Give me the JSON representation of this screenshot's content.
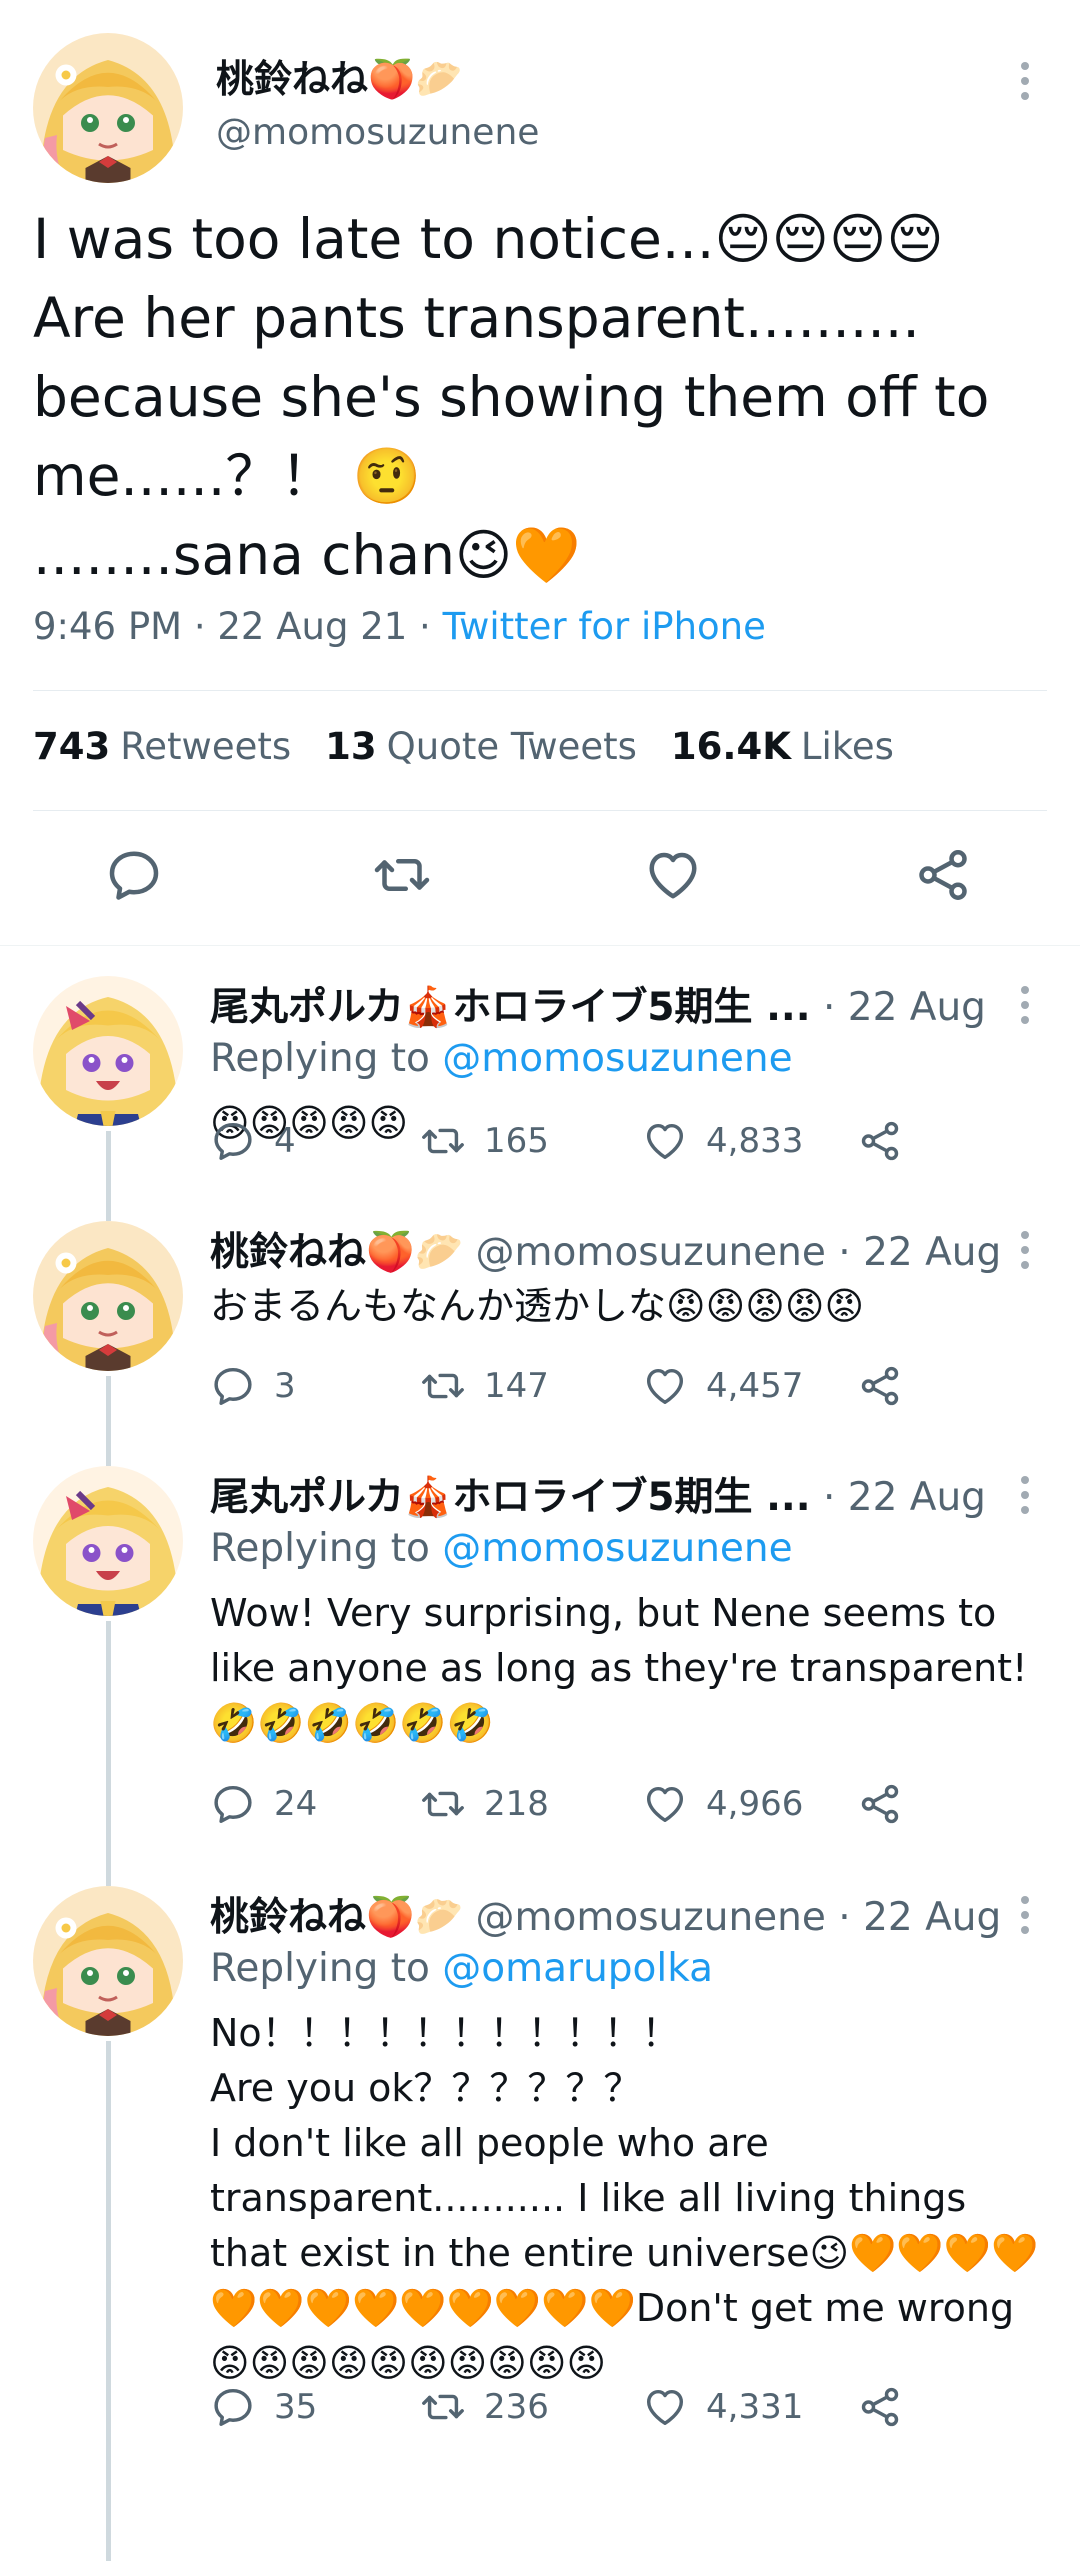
{
  "main_tweet": {
    "name": "桃鈴ねね🍑🥟",
    "handle": "@momosuzunene",
    "text": "I was too late to notice...😔😔😔😔\nAre her pants transparent..........\nbecause she's showing them off to\nme......？！ 🤨\n........sana chan😉🧡",
    "time": "9:46 PM · 22 Aug 21 · ",
    "source": "Twitter for iPhone",
    "stats": [
      {
        "count": "743",
        "label": "Retweets"
      },
      {
        "count": "13",
        "label": "Quote Tweets"
      },
      {
        "count": "16.4K",
        "label": "Likes"
      }
    ],
    "action_icons": [
      "reply-icon",
      "retweet-icon",
      "like-icon",
      "share-icon"
    ]
  },
  "replies": [
    {
      "name": "尾丸ポルカ🎪ホロライブ5期生 ...",
      "handle": "",
      "date": " · 22 Aug",
      "replying_label": "Replying to ",
      "replying_to": "@momosuzunene",
      "text": "😡😡😡😡😡",
      "reply_count": "4",
      "retweet_count": "165",
      "like_count": "4,833"
    },
    {
      "name": "桃鈴ねね🍑🥟",
      "handle": " @momosuzunene",
      "date": " · 22 Aug",
      "replying_label": "",
      "replying_to": "",
      "text": "おまるんもなんか透かしな😡😡😡😡😡",
      "reply_count": "3",
      "retweet_count": "147",
      "like_count": "4,457"
    },
    {
      "name": "尾丸ポルカ🎪ホロライブ5期生 ...",
      "handle": "",
      "date": " · 22 Aug",
      "replying_label": "Replying to ",
      "replying_to": "@momosuzunene",
      "text": "Wow! Very surprising, but Nene seems to like anyone as long as they're transparent!\n🤣🤣🤣🤣🤣🤣",
      "reply_count": "24",
      "retweet_count": "218",
      "like_count": "4,966"
    },
    {
      "name": "桃鈴ねね🍑🥟",
      "handle": " @momosuzunene",
      "date": " · 22 Aug",
      "replying_label": "Replying to ",
      "replying_to": "@omarupolka",
      "text": "No！！！！！！！！！！！\nAre you ok？？？？？？\nI don't like all people who are transparent........... I like all living things that exist in the entire universe😉🧡🧡🧡🧡🧡🧡🧡🧡🧡🧡🧡🧡🧡Don't get me wrong😡😡😡😡😡😡😡😡😡😡",
      "reply_count": "35",
      "retweet_count": "236",
      "like_count": "4,331"
    }
  ],
  "colors": {
    "accent": "#1d9bf0",
    "muted": "#536471",
    "text": "#0f1419",
    "thread_line": "#cfd9de"
  }
}
